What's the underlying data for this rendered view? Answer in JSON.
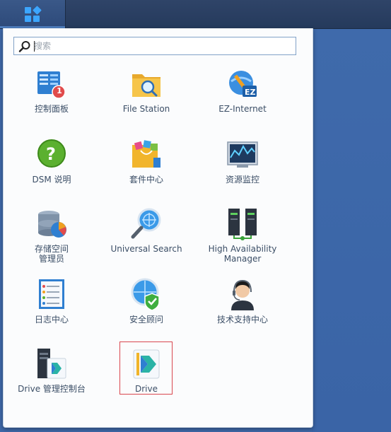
{
  "taskbar": {
    "main_menu_icon": "grid-menu-icon"
  },
  "search": {
    "placeholder": "搜索",
    "value": ""
  },
  "apps": [
    {
      "label": "控制面板",
      "icon": "control-panel-icon",
      "badge": "1"
    },
    {
      "label": "File Station",
      "icon": "folder-search-icon"
    },
    {
      "label": "EZ-Internet",
      "icon": "ez-internet-icon"
    },
    {
      "label": "DSM 说明",
      "icon": "help-icon"
    },
    {
      "label": "套件中心",
      "icon": "package-center-icon"
    },
    {
      "label": "资源监控",
      "icon": "resource-monitor-icon"
    },
    {
      "label": "存储空间\n管理员",
      "icon": "storage-manager-icon"
    },
    {
      "label": "Universal Search",
      "icon": "universal-search-icon"
    },
    {
      "label": "High Availability\nManager",
      "icon": "high-availability-icon"
    },
    {
      "label": "日志中心",
      "icon": "log-center-icon"
    },
    {
      "label": "安全顾问",
      "icon": "security-advisor-icon"
    },
    {
      "label": "技术支持中心",
      "icon": "support-center-icon"
    },
    {
      "label": "Drive 管理控制台",
      "icon": "drive-admin-console-icon"
    },
    {
      "label": "Drive",
      "icon": "drive-icon",
      "selected": true
    }
  ],
  "colors": {
    "accent": "#3ca6ff",
    "selection": "#d9474f",
    "badge": "#e14b4b"
  }
}
